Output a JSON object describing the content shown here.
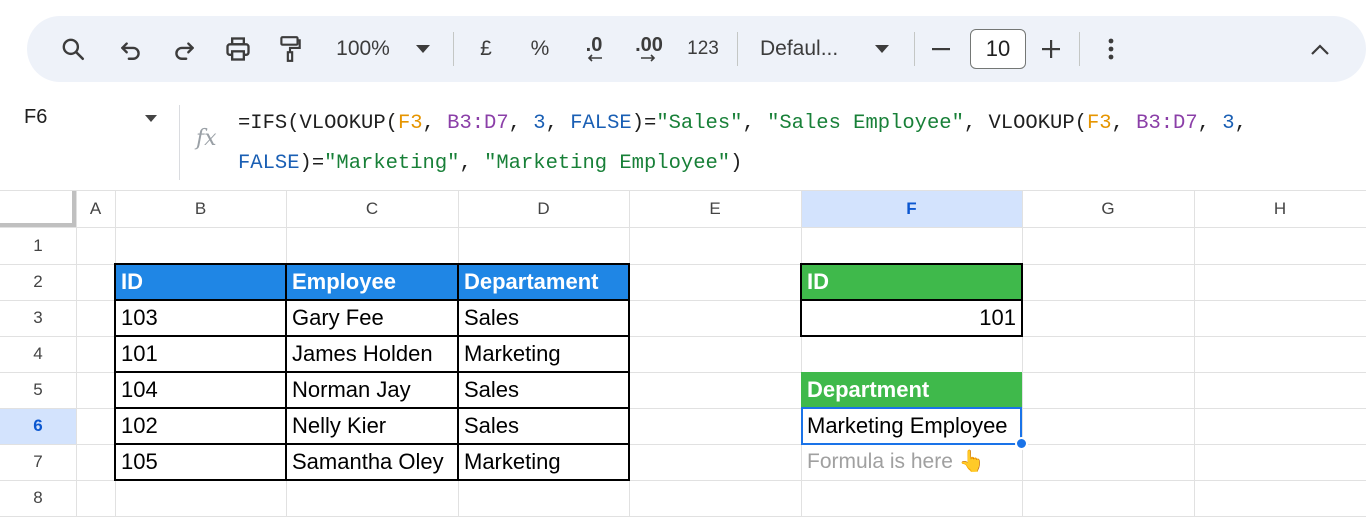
{
  "toolbar": {
    "zoom": "100%",
    "currency": "£",
    "percent": "%",
    "decrease_decimal": ".0",
    "increase_decimal": ".00",
    "more_formats": "123",
    "font": "Defaul...",
    "font_size": "10"
  },
  "formula_bar": {
    "cell_ref": "F6",
    "fx": "fx",
    "formula": {
      "p1": "=IFS(VLOOKUP(",
      "r1": "F3",
      "p2": ", ",
      "r2": "B3:D7",
      "p3": ", ",
      "n1": "3",
      "p4": ", ",
      "k1": "FALSE",
      "p5": ")=",
      "s1": "\"Sales\"",
      "p6": ", ",
      "s2": "\"Sales Employee\"",
      "p7": ", VLOOKUP(",
      "r3": "F3",
      "p8": ", ",
      "r4": "B3:D7",
      "p9": ", ",
      "n2": "3",
      "p10": ",\n",
      "k2": "FALSE",
      "p11": ")=",
      "s3": "\"Marketing\"",
      "p12": ", ",
      "s4": "\"Marketing Employee\"",
      "p13": ")"
    }
  },
  "columns": [
    "A",
    "B",
    "C",
    "D",
    "E",
    "F",
    "G",
    "H"
  ],
  "rows": [
    "1",
    "2",
    "3",
    "4",
    "5",
    "6",
    "7",
    "8"
  ],
  "selected": {
    "column": "F",
    "row": "6"
  },
  "table": {
    "headers": [
      "ID",
      "Employee",
      "Departament"
    ],
    "rows": [
      [
        "103",
        "Gary Fee",
        "Sales"
      ],
      [
        "101",
        "James Holden",
        "Marketing"
      ],
      [
        "104",
        "Norman Jay",
        "Sales"
      ],
      [
        "102",
        "Nelly Kier",
        "Sales"
      ],
      [
        "105",
        "Samantha Oley",
        "Marketing"
      ]
    ]
  },
  "lookup": {
    "id_label": "ID",
    "id_value": "101",
    "dept_label": "Department",
    "dept_value": "Marketing Employee",
    "note": "Formula is here 👆"
  },
  "colors": {
    "table_header": "#1f86e5",
    "lookup_header": "#3fb94b",
    "selection": "#1a73e8"
  }
}
